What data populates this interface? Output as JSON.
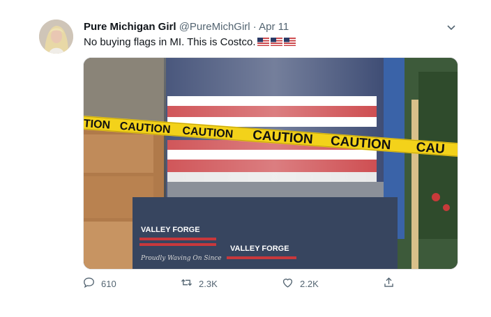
{
  "tweet": {
    "display_name": "Pure Michigan Girl",
    "handle": "@PureMichGirl",
    "separator": "·",
    "date": "Apr 11",
    "text": "No buying flags in MI. This is Costco.",
    "emoji": [
      "us-flag-emoji",
      "us-flag-emoji",
      "us-flag-emoji"
    ]
  },
  "media": {
    "tape_text": [
      "TION",
      "CAUTION",
      "CAUTION",
      "CAUTION",
      "CAUTION",
      "CAU"
    ],
    "box_brand": "VALLEY FORGE",
    "box_tagline": "Proudly Waving On Since",
    "colors": {
      "tape": "#f3d21a",
      "flag_red": "#c8383c",
      "flag_blue": "#2a3a66",
      "box": "#2b3a55"
    }
  },
  "actions": {
    "reply_count": "610",
    "retweet_count": "2.3K",
    "like_count": "2.2K"
  },
  "icons": {
    "caret": "chevron-down-icon",
    "reply": "reply-icon",
    "retweet": "retweet-icon",
    "like": "heart-icon",
    "share": "share-icon"
  }
}
